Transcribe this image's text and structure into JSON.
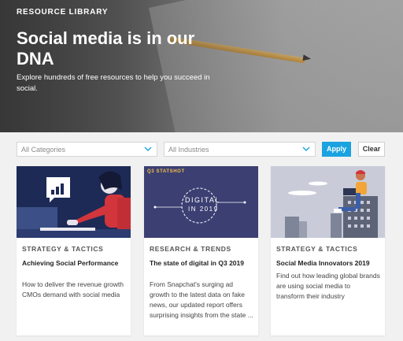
{
  "hero": {
    "eyebrow": "RESOURCE LIBRARY",
    "title": "Social media is in our DNA",
    "subtitle": "Explore hundreds of free resources to help you succeed in social."
  },
  "filters": {
    "categories_placeholder": "All Categories",
    "industries_placeholder": "All Industries",
    "apply_label": "Apply",
    "clear_label": "Clear",
    "accent_color": "#1aa3e0"
  },
  "cards": [
    {
      "category": "STRATEGY & TACTICS",
      "title": "Achieving Social Performance",
      "description": "How to deliver the revenue growth CMOs demand with social media",
      "thumb_bg": "#1d2a56"
    },
    {
      "category": "RESEARCH & TRENDS",
      "title": "The state of digital in Q3 2019",
      "description": "From Snapchat's surging ad growth to the latest data on fake news, our updated report offers surprising insights from the state ...",
      "thumb_bg": "#3b3f72",
      "thumb_label": "Q3 STATSHOT",
      "thumb_text_1": "DIGITAL",
      "thumb_text_2": "IN 2019"
    },
    {
      "category": "STRATEGY & TACTICS",
      "title": "Social Media Innovators 2019",
      "description": "Find out how leading global brands are using social media to transform their industry",
      "thumb_bg": "#c9ccd8"
    }
  ]
}
